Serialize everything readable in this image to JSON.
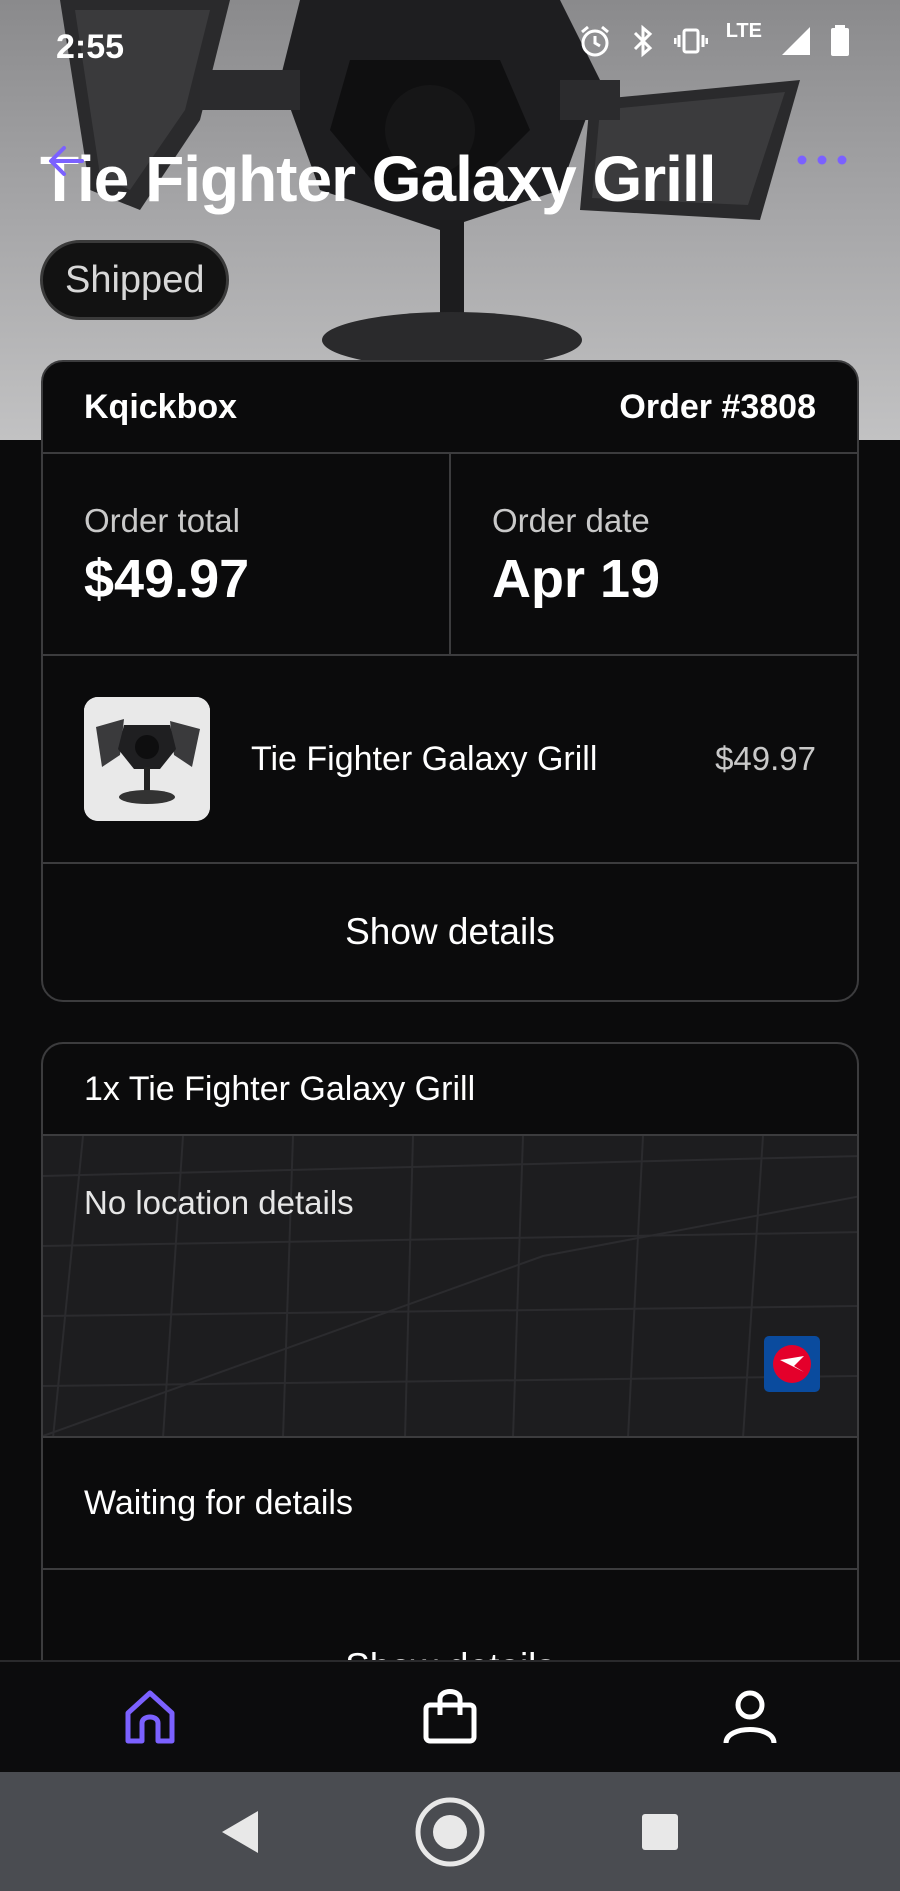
{
  "status_bar": {
    "time": "2:55",
    "network": "LTE"
  },
  "header": {
    "title": "Tie Fighter Galaxy Grill",
    "status": "Shipped"
  },
  "order": {
    "store": "Kqickbox",
    "number": "Order #3808",
    "total_label": "Order total",
    "total_value": "$49.97",
    "date_label": "Order date",
    "date_value": "Apr 19",
    "item": {
      "name": "Tie Fighter Galaxy Grill",
      "price": "$49.97"
    },
    "show_details": "Show details"
  },
  "shipment": {
    "title": "1x Tie Fighter Galaxy Grill",
    "location_text": "No location details",
    "carrier_icon": "canada-post-icon",
    "waiting_text": "Waiting for details",
    "show_details": "Show details"
  },
  "bottom_nav": {
    "items": [
      "home-icon",
      "bag-icon",
      "profile-icon"
    ],
    "active": "home"
  },
  "colors": {
    "accent": "#7b61ff",
    "background": "#0b0b0c",
    "border": "#3c3c3e"
  }
}
